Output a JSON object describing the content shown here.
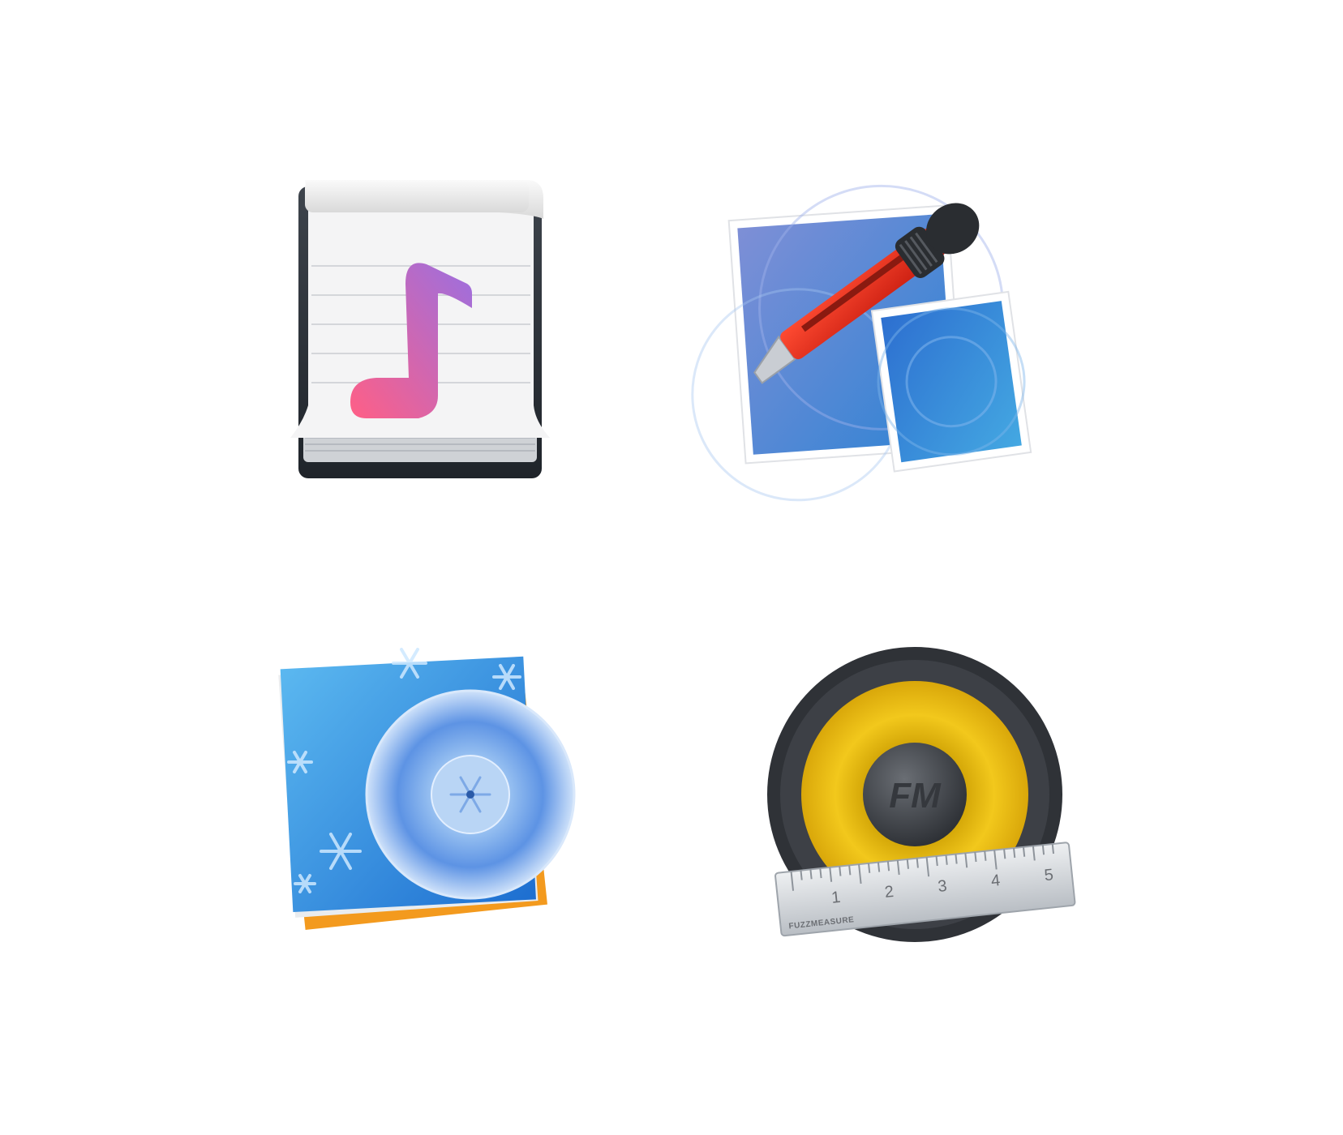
{
  "icons": [
    {
      "id": "music-notepad",
      "icon": "music-note-notepad-icon",
      "accent": [
        "#f4527f",
        "#a56fd9"
      ]
    },
    {
      "id": "image-cutter",
      "icon": "utility-knife-photos-icon",
      "accent": [
        "#e8321e",
        "#2f67c7"
      ]
    },
    {
      "id": "disc-burner",
      "icon": "snowflake-disc-case-icon",
      "accent": [
        "#3d9ee4",
        "#f39a1e"
      ]
    },
    {
      "id": "fuzzmeasure",
      "icon": "speaker-ruler-icon",
      "accent": [
        "#e9b912",
        "#2f3237"
      ],
      "logo": "FM",
      "ruler": {
        "numbers": [
          "1",
          "2",
          "3",
          "4",
          "5"
        ],
        "brand": "FUZZMEASURE"
      }
    }
  ]
}
